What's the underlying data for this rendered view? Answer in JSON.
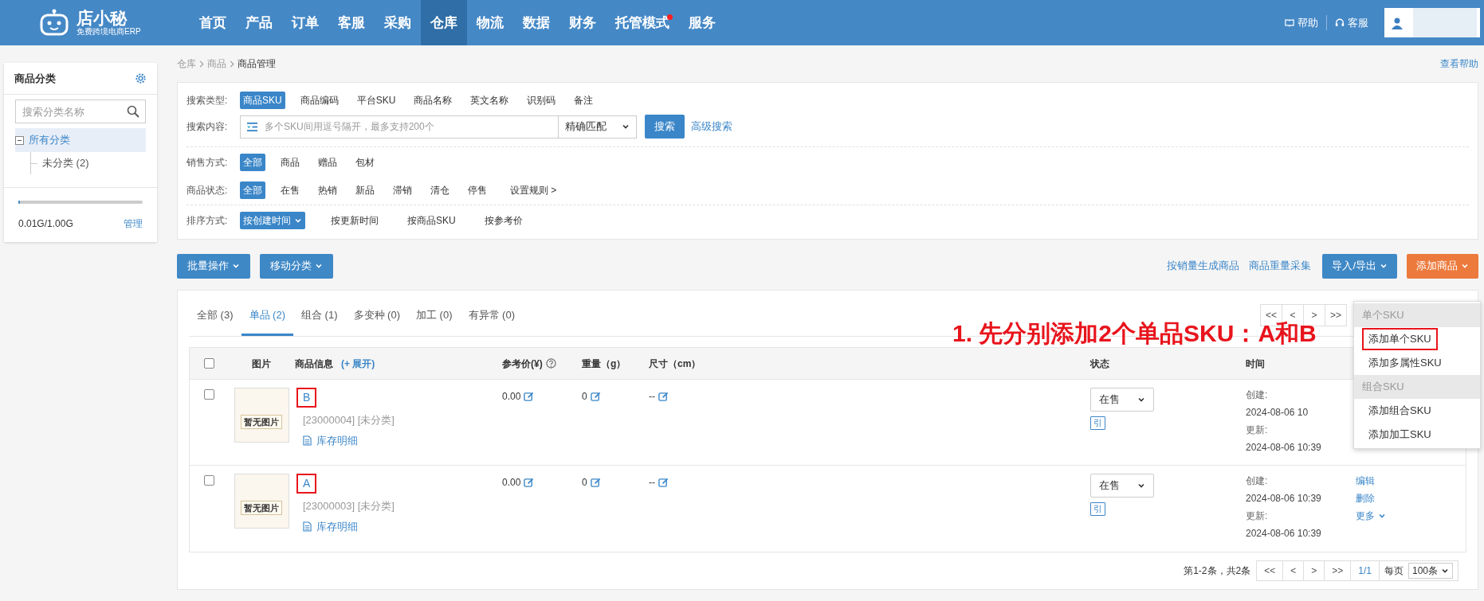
{
  "logo": {
    "name": "店小秘",
    "tagline": "免费跨境电商ERP"
  },
  "nav": [
    {
      "label": "首页",
      "selected": false,
      "dot": false
    },
    {
      "label": "产品",
      "selected": false,
      "dot": false
    },
    {
      "label": "订单",
      "selected": false,
      "dot": false
    },
    {
      "label": "客服",
      "selected": false,
      "dot": false
    },
    {
      "label": "采购",
      "selected": false,
      "dot": false
    },
    {
      "label": "仓库",
      "selected": true,
      "dot": false
    },
    {
      "label": "物流",
      "selected": false,
      "dot": false
    },
    {
      "label": "数据",
      "selected": false,
      "dot": false
    },
    {
      "label": "财务",
      "selected": false,
      "dot": false
    },
    {
      "label": "托管模式",
      "selected": false,
      "dot": true
    },
    {
      "label": "服务",
      "selected": false,
      "dot": false
    }
  ],
  "header_links": [
    "帮助",
    "客服"
  ],
  "sidebar": {
    "title": "商品分类",
    "search_placeholder": "搜索分类名称",
    "tree": [
      {
        "label": "所有分类",
        "selected": true,
        "expanded": true,
        "children": [
          {
            "label": "未分类 (2)",
            "selected": false
          }
        ]
      }
    ],
    "storage": {
      "level": 0.01,
      "reading": "0.01G/1.00G",
      "link": "管理"
    }
  },
  "breadcrumb": [
    "仓库",
    "商品",
    "商品管理"
  ],
  "help_link": "查看帮助",
  "filters": {
    "search_type": {
      "label": "搜索类型:",
      "options": [
        {
          "label": "商品SKU",
          "selected": true
        },
        {
          "label": "商品编码",
          "selected": false
        },
        {
          "label": "平台SKU",
          "selected": false
        },
        {
          "label": "商品名称",
          "selected": false
        },
        {
          "label": "英文名称",
          "selected": false
        },
        {
          "label": "识别码",
          "selected": false
        },
        {
          "label": "备注",
          "selected": false
        }
      ]
    },
    "search_content": {
      "label": "搜索内容:",
      "placeholder": "多个SKU间用逗号隔开，最多支持200个",
      "match": "精确匹配",
      "button": "搜索",
      "advanced": "高级搜索"
    },
    "sale_mode": {
      "label": "销售方式:",
      "options": [
        {
          "label": "全部",
          "selected": true
        },
        {
          "label": "商品",
          "selected": false
        },
        {
          "label": "赠品",
          "selected": false
        },
        {
          "label": "包材",
          "selected": false
        }
      ]
    },
    "status": {
      "label": "商品状态:",
      "options": [
        {
          "label": "全部",
          "selected": true,
          "kind": "option"
        },
        {
          "label": "在售",
          "selected": false,
          "kind": "option"
        },
        {
          "label": "热销",
          "selected": false,
          "kind": "option"
        },
        {
          "label": "新品",
          "selected": false,
          "kind": "option"
        },
        {
          "label": "滞销",
          "selected": false,
          "kind": "option"
        },
        {
          "label": "清仓",
          "selected": false,
          "kind": "option"
        },
        {
          "label": "停售",
          "selected": false,
          "kind": "option"
        },
        {
          "label": "设置规则 >",
          "selected": false,
          "kind": "link"
        }
      ]
    },
    "sort": {
      "label": "排序方式:",
      "options": [
        {
          "label": "按创建时间",
          "selected": true
        },
        {
          "label": "按更新时间",
          "selected": false
        },
        {
          "label": "按商品SKU",
          "selected": false
        },
        {
          "label": "按参考价",
          "selected": false
        }
      ]
    }
  },
  "toolbar": {
    "left": [
      "批量操作",
      "移动分类"
    ],
    "links": [
      "按销量生成商品",
      "商品重量采集"
    ],
    "import_export": "导入/导出",
    "add": "添加商品"
  },
  "tabs": [
    {
      "label": "全部 (3)",
      "selected": false
    },
    {
      "label": "单品 (2)",
      "selected": true
    },
    {
      "label": "组合 (1)",
      "selected": false
    },
    {
      "label": "多变种 (0)",
      "selected": false
    },
    {
      "label": "加工 (0)",
      "selected": false
    },
    {
      "label": "有异常 (0)",
      "selected": false
    }
  ],
  "top_pager": [
    "<<",
    "<",
    ">",
    ">>"
  ],
  "annotation": "1. 先分别添加2个单品SKU：A和B",
  "table": {
    "all_checked": false,
    "columns": [
      "图片",
      "商品信息",
      "参考价(¥)",
      "重量（g）",
      "尺寸（cm）",
      "状态",
      "时间"
    ],
    "expand": "(+ 展开)",
    "rows": [
      {
        "checked": false,
        "image": "暂无图片",
        "name": "B",
        "annotated": true,
        "meta": "[23000004] [未分类]",
        "stock_link": "库存明细",
        "price": "0.00",
        "weight": "0",
        "size": "--",
        "status": "在售",
        "tag": "引",
        "created_label": "创建:",
        "created": "2024-08-06 10",
        "updated_label": "更新:",
        "updated": "2024-08-06 10:39"
      },
      {
        "checked": false,
        "image": "暂无图片",
        "name": "A",
        "annotated": true,
        "meta": "[23000003] [未分类]",
        "stock_link": "库存明细",
        "price": "0.00",
        "weight": "0",
        "size": "--",
        "status": "在售",
        "tag": "引",
        "created_label": "创建:",
        "created": "2024-08-06 10:39",
        "updated_label": "更新:",
        "updated": "2024-08-06 10:39",
        "actions": [
          "编辑",
          "删除",
          "更多"
        ]
      }
    ]
  },
  "pager": {
    "summary": "第1-2条，共2条",
    "buttons": [
      {
        "label": "<<",
        "selected": false
      },
      {
        "label": "<",
        "selected": false
      },
      {
        "label": ">",
        "selected": false
      },
      {
        "label": ">>",
        "selected": false
      },
      {
        "label": "1/1",
        "selected": true
      }
    ],
    "per_page_label": "每页",
    "per_page": "100条"
  },
  "add_menu": [
    {
      "label": "单个SKU",
      "kind": "header"
    },
    {
      "label": "添加单个SKU",
      "kind": "item",
      "annotated": true
    },
    {
      "label": "添加多属性SKU",
      "kind": "item",
      "annotated": false
    },
    {
      "label": "组合SKU",
      "kind": "header"
    },
    {
      "label": "添加组合SKU",
      "kind": "item",
      "annotated": false
    },
    {
      "label": "添加加工SKU",
      "kind": "item",
      "annotated": false
    }
  ]
}
